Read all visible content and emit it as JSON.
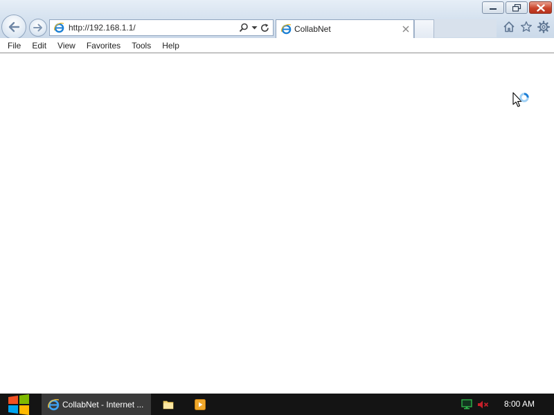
{
  "browser": {
    "address": {
      "value": "http://192.168.1.1/"
    },
    "active_tab": {
      "label": "CollabNet"
    }
  },
  "menubar": {
    "items": [
      {
        "label": "File"
      },
      {
        "label": "Edit"
      },
      {
        "label": "View"
      },
      {
        "label": "Favorites"
      },
      {
        "label": "Tools"
      },
      {
        "label": "Help"
      }
    ]
  },
  "icons": {
    "window": [
      "minimize-icon",
      "restore-icon",
      "close-icon"
    ],
    "nav": [
      "back-arrow-icon",
      "forward-arrow-icon"
    ],
    "address": [
      "ie-favicon",
      "search-icon",
      "dropdown-arrow-icon",
      "refresh-icon"
    ],
    "toolbar": [
      "home-icon",
      "favorites-star-icon",
      "settings-gear-icon"
    ],
    "taskbar": [
      "windows-logo-icon",
      "internet-explorer-icon",
      "file-explorer-icon",
      "media-player-icon"
    ],
    "tray": [
      "network-icon",
      "volume-muted-icon"
    ],
    "content": [
      "busy-cursor-icon"
    ]
  },
  "taskbar": {
    "active_task_label": "CollabNet - Internet ...",
    "clock": "8:00 AM"
  },
  "colors": {
    "close_button": "#c9452c",
    "taskbar_bg": "#141414",
    "active_task_bg": "#3a3a3a",
    "ie_blue": "#1a7fd4"
  }
}
